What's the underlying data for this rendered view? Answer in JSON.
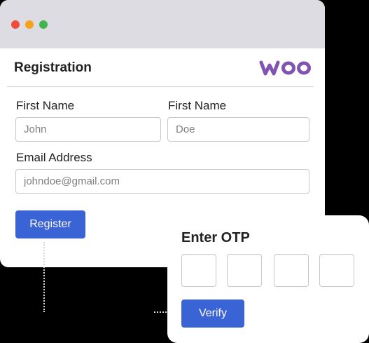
{
  "window": {
    "controls": [
      "close",
      "minimize",
      "maximize"
    ]
  },
  "registration": {
    "title": "Registration",
    "brand": "woo",
    "brand_color": "#7f54b3",
    "first_name_label": "First Name",
    "first_name_placeholder": "John",
    "last_name_label": "First Name",
    "last_name_placeholder": "Doe",
    "email_label": "Email Address",
    "email_placeholder": "johndoe@gmail.com",
    "register_label": "Register"
  },
  "otp": {
    "title": "Enter OTP",
    "digits": [
      "",
      "",
      "",
      ""
    ],
    "verify_label": "Verify"
  },
  "colors": {
    "accent": "#3a63d6",
    "titlebar": "#dcdce2",
    "dot_red": "#f24a3f",
    "dot_yellow": "#f7a21b",
    "dot_green": "#3fb54d"
  }
}
